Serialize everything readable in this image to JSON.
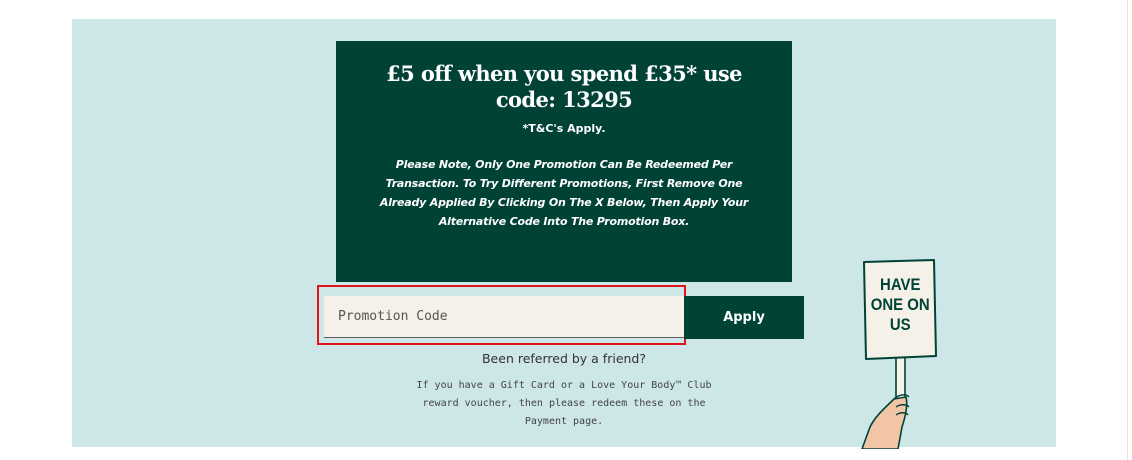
{
  "promo_banner": {
    "headline": "£5 off when you spend £35* use code: 13295",
    "terms": "*T&C's Apply.",
    "note": "Please Note, Only One Promotion Can Be Redeemed Per Transaction. To Try Different Promotions, First Remove One Already Applied By Clicking On The X Below, Then Apply Your Alternative Code Into The Promotion Box."
  },
  "promo_form": {
    "placeholder": "Promotion Code",
    "value": "",
    "apply_label": "Apply"
  },
  "referral": {
    "link_text": "Been referred by a friend?"
  },
  "gift_card_note": "If you have a Gift Card or a Love Your Body™ Club reward voucher, then please redeem these on the Payment page.",
  "illustration": {
    "icon": "hand-holding-sign-icon",
    "sign_lines": [
      "HAVE",
      "ONE ON",
      "US"
    ]
  },
  "colors": {
    "panel_bg": "#cde6e7",
    "brand_green": "#004236",
    "input_bg": "#f5f1e8",
    "highlight": "#e2141b"
  }
}
